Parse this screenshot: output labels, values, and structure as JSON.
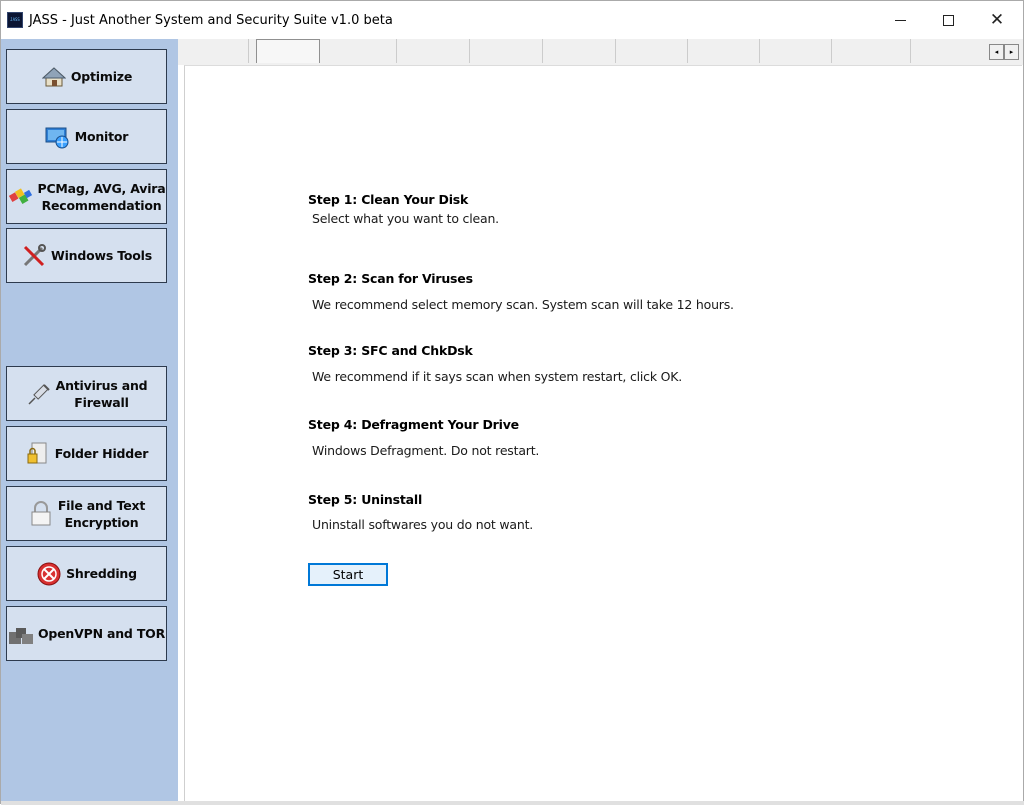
{
  "window": {
    "title": "JASS - Just Another System and Security Suite v1.0 beta",
    "icon_text": "JASS",
    "minimize_icon": "minimize-icon",
    "maximize_icon": "maximize-icon",
    "close_icon": "close-icon"
  },
  "sidebar": {
    "items": [
      {
        "label": "Optimize",
        "icon": "house-icon"
      },
      {
        "label": "Monitor",
        "icon": "monitor-icon"
      },
      {
        "label": "PCMag, AVG, Avira Recommendation",
        "line1": "PCMag, AVG, Avira",
        "line2": "Recommendation",
        "icon": "colorful-blocks-icon"
      },
      {
        "label": "Windows Tools",
        "icon": "tools-icon"
      },
      {
        "label": "Antivirus and Firewall",
        "line1": "Antivirus and",
        "line2": "Firewall",
        "icon": "syringe-icon"
      },
      {
        "label": "Folder Hidder",
        "icon": "folder-lock-icon"
      },
      {
        "label": "File and Text Encryption",
        "line1": "File and Text",
        "line2": "Encryption",
        "icon": "padlock-icon"
      },
      {
        "label": "Shredding",
        "icon": "shredder-icon"
      },
      {
        "label": "OpenVPN and TOR",
        "icon": "network-icon"
      }
    ]
  },
  "tabs": {
    "scroll_left": "◂",
    "scroll_right": "▸"
  },
  "steps": [
    {
      "title": "Step 1: Clean Your Disk",
      "desc": "Select what you want to clean."
    },
    {
      "title": "Step 2: Scan for Viruses",
      "desc": "We recommend select memory scan. System scan will take 12 hours."
    },
    {
      "title": "Step 3: SFC and ChkDsk",
      "desc": "We recommend if it says scan when system restart, click OK."
    },
    {
      "title": "Step 4: Defragment Your Drive",
      "desc": "Windows Defragment. Do not restart."
    },
    {
      "title": "Step 5: Uninstall",
      "desc": "Uninstall softwares you do not want."
    }
  ],
  "start_button": {
    "label": "Start"
  },
  "colors": {
    "sidebar_bg": "#b0c6e4",
    "button_bg": "#d5e0ef",
    "accent": "#0078d7"
  }
}
